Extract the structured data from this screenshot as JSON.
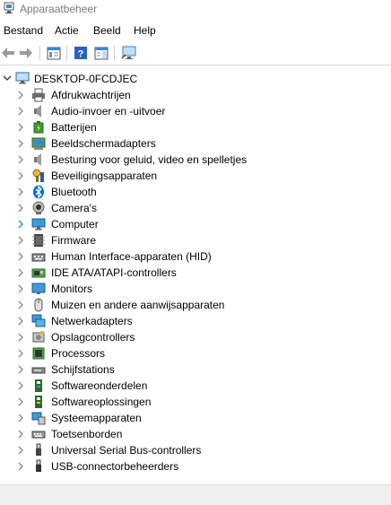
{
  "window": {
    "title": "Apparaatbeheer"
  },
  "menu": [
    "Bestand",
    "Actie",
    "Beeld",
    "Help"
  ],
  "toolbar": {
    "buttons": [
      "back-arrow-icon",
      "forward-arrow-icon",
      "properties-view-icon",
      "help-icon",
      "action-pane-icon",
      "monitor-scan-icon"
    ]
  },
  "tree": {
    "root": "DESKTOP-0FCDJEC",
    "items": [
      {
        "label": "Afdrukwachtrijen",
        "icon": "printer-icon"
      },
      {
        "label": "Audio-invoer en -uitvoer",
        "icon": "speaker-icon"
      },
      {
        "label": "Batterijen",
        "icon": "battery-icon"
      },
      {
        "label": "Beeldschermadapters",
        "icon": "display-adapter-icon"
      },
      {
        "label": "Besturing voor geluid, video en spelletjes",
        "icon": "sound-video-icon"
      },
      {
        "label": "Beveiligingsapparaten",
        "icon": "security-key-icon"
      },
      {
        "label": "Bluetooth",
        "icon": "bluetooth-icon"
      },
      {
        "label": "Camera's",
        "icon": "camera-icon"
      },
      {
        "label": "Computer",
        "icon": "computer-icon"
      },
      {
        "label": "Firmware",
        "icon": "firmware-chip-icon"
      },
      {
        "label": "Human Interface-apparaten (HID)",
        "icon": "keyboard-hid-icon"
      },
      {
        "label": "IDE ATA/ATAPI-controllers",
        "icon": "ide-controller-icon"
      },
      {
        "label": "Monitors",
        "icon": "monitor-icon"
      },
      {
        "label": "Muizen en andere aanwijsapparaten",
        "icon": "mouse-icon"
      },
      {
        "label": "Netwerkadapters",
        "icon": "network-adapter-icon"
      },
      {
        "label": "Opslagcontrollers",
        "icon": "storage-controller-icon"
      },
      {
        "label": "Processors",
        "icon": "processor-icon"
      },
      {
        "label": "Schijfstations",
        "icon": "disk-drive-icon"
      },
      {
        "label": "Softwareonderdelen",
        "icon": "software-component-icon"
      },
      {
        "label": "Softwareoplossingen",
        "icon": "software-solution-icon"
      },
      {
        "label": "Systeemapparaten",
        "icon": "system-device-icon"
      },
      {
        "label": "Toetsenborden",
        "icon": "keyboard-icon"
      },
      {
        "label": "Universal Serial Bus-controllers",
        "icon": "usb-icon"
      },
      {
        "label": "USB-connectorbeheerders",
        "icon": "usb-connector-icon"
      }
    ]
  },
  "colors": {
    "accent": "#0078d7",
    "chevron": "#7a7a7a",
    "title_text": "#7a7a7a",
    "statusbar": "#f0f0f0"
  }
}
